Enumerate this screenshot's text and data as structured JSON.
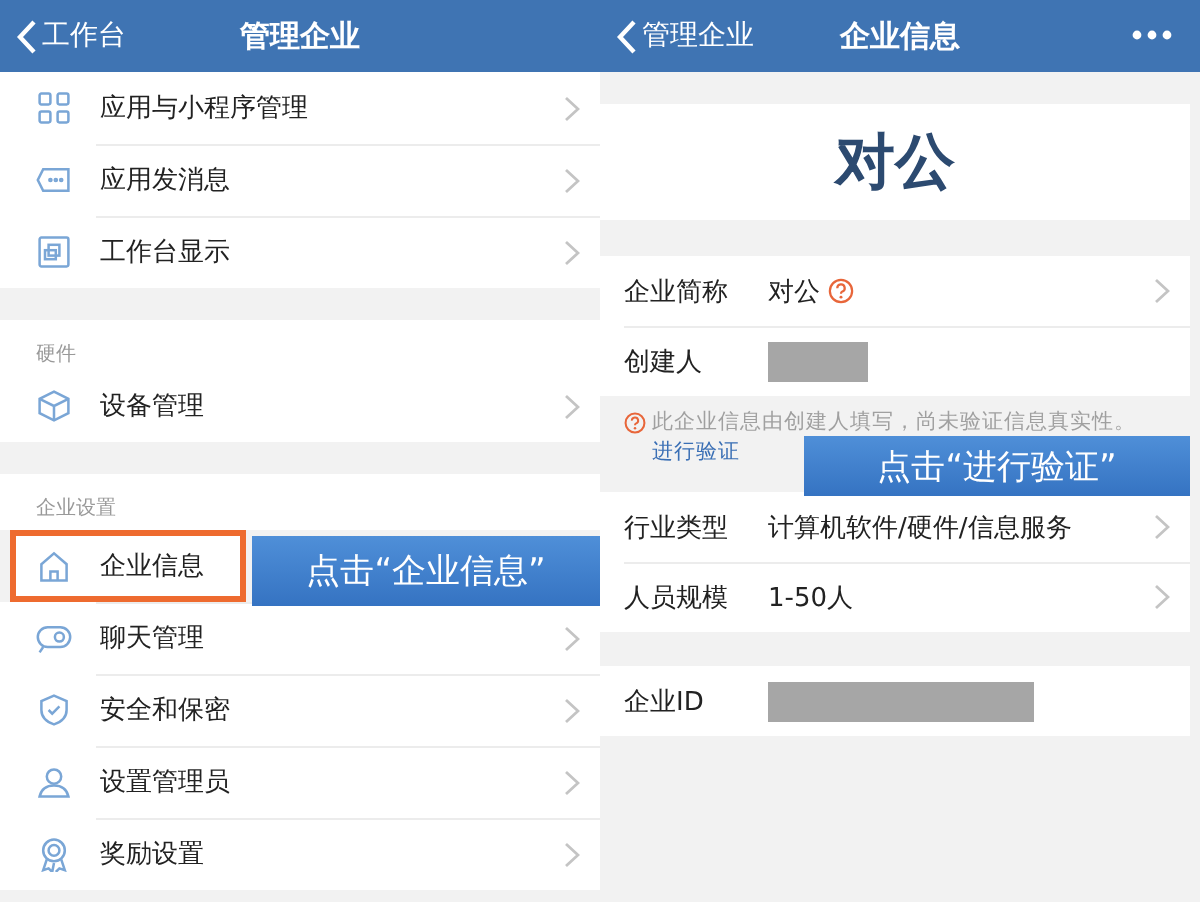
{
  "left_screen": {
    "nav": {
      "back": "工作台",
      "title": "管理企业"
    },
    "sections": [
      {
        "items": [
          {
            "label": "应用与小程序管理",
            "highlighted": false
          },
          {
            "label": "应用发消息",
            "highlighted": false
          },
          {
            "label": "工作台显示",
            "highlighted": false
          }
        ]
      },
      {
        "header": "硬件",
        "items": [
          {
            "label": "设备管理",
            "highlighted": false
          }
        ]
      },
      {
        "header": "企业设置",
        "items": [
          {
            "label": "企业信息",
            "highlighted": true
          },
          {
            "label": "聊天管理",
            "highlighted": false
          },
          {
            "label": "安全和保密",
            "highlighted": false
          },
          {
            "label": "设置管理员",
            "highlighted": false
          },
          {
            "label": "奖励设置",
            "highlighted": false
          }
        ]
      }
    ],
    "callout": {
      "text": "点击“企业信息”"
    }
  },
  "right_screen": {
    "nav": {
      "back": "管理企业",
      "title": "企业信息"
    },
    "company_name": "对公",
    "groups": [
      {
        "rows": [
          {
            "label": "企业简称",
            "value": "对公",
            "redacted": false,
            "help": true,
            "chevron": true
          },
          {
            "label": "创建人",
            "redacted": true,
            "help": false,
            "chevron": false
          }
        ],
        "note": {
          "text": "此企业信息由创建人填写，尚未验证信息真实性。",
          "link": "进行验证"
        }
      },
      {
        "rows": [
          {
            "label": "行业类型",
            "value": "计算机软件/硬件/信息服务",
            "redacted": false,
            "help": false,
            "chevron": true
          },
          {
            "label": "人员规模",
            "value": "1-50人",
            "redacted": false,
            "help": false,
            "chevron": true
          }
        ]
      },
      {
        "rows": [
          {
            "label": "企业ID",
            "redacted": true,
            "help": false,
            "chevron": false,
            "wide": true
          }
        ]
      }
    ],
    "callout": {
      "text": "点击“进行验证”"
    }
  }
}
